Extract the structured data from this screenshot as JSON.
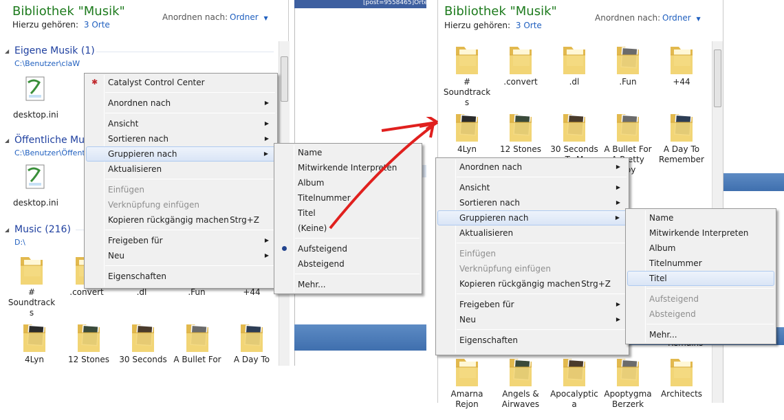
{
  "left": {
    "title": "Bibliothek \"Musik\"",
    "subtitle_prefix": "Hierzu gehören:",
    "subtitle_link": "3 Orte",
    "arrange_label": "Anordnen nach:",
    "arrange_value": "Ordner",
    "groups": [
      {
        "name": "Eigene Musik (1)",
        "path": "C:\\Benutzer\\claW",
        "items": [
          "desktop.ini"
        ]
      },
      {
        "name": "Öffentliche Musik",
        "path": "C:\\Benutzer\\Öffentlich",
        "items": [
          "desktop.ini"
        ]
      },
      {
        "name": "Music (216)",
        "path": "D:\\",
        "items": [
          "# Soundtracks",
          ".convert",
          ".dl",
          ".Fun",
          "+44",
          "4Lyn",
          "12 Stones",
          "30 Seconds",
          "A Bullet For",
          "A Day To"
        ]
      }
    ],
    "middle_header": "[post=9558465]Orte"
  },
  "menu_left": {
    "items": [
      {
        "label": "Catalyst Control Center",
        "icon": "catalyst-icon"
      },
      {
        "label": "Anordnen nach",
        "submenu": true
      },
      {
        "label": "Ansicht",
        "submenu": true
      },
      {
        "label": "Sortieren nach",
        "submenu": true
      },
      {
        "label": "Gruppieren nach",
        "submenu": true,
        "highlighted": true
      },
      {
        "label": "Aktualisieren"
      },
      {
        "label": "Einfügen",
        "disabled": true
      },
      {
        "label": "Verknüpfung einfügen",
        "disabled": true
      },
      {
        "label": "Kopieren rückgängig machen",
        "shortcut": "Strg+Z"
      },
      {
        "label": "Freigeben für",
        "submenu": true
      },
      {
        "label": "Neu",
        "submenu": true
      },
      {
        "label": "Eigenschaften"
      }
    ]
  },
  "submenu_left": {
    "items": [
      "Name",
      "Mitwirkende Interpreten",
      "Album",
      "Titelnummer",
      "Titel",
      "(Keine)",
      "Aufsteigend",
      "Absteigend",
      "Mehr..."
    ],
    "selected": "Aufsteigend"
  },
  "right": {
    "title": "Bibliothek \"Musik\"",
    "subtitle_prefix": "Hierzu gehören:",
    "subtitle_link": "3 Orte",
    "arrange_label": "Anordnen nach:",
    "arrange_value": "Ordner",
    "row1": [
      "# Soundtracks",
      ".convert",
      ".dl",
      ".Fun",
      "+44"
    ],
    "row2": [
      "4Lyn",
      "12 Stones",
      "30 Seconds To M",
      "A Bullet For A Pretty Boy",
      "A Day To Remember"
    ],
    "row_bottom": [
      "Amarna Rejon",
      "Angels & Airwaves",
      "Apocalyptica",
      "Apoptygma Berzerk",
      "Architects"
    ],
    "partial_label": "Remains"
  },
  "menu_right": {
    "items": [
      {
        "label": "Anordnen nach",
        "submenu": true
      },
      {
        "label": "Ansicht",
        "submenu": true
      },
      {
        "label": "Sortieren nach",
        "submenu": true
      },
      {
        "label": "Gruppieren nach",
        "submenu": true,
        "highlighted": true
      },
      {
        "label": "Aktualisieren"
      },
      {
        "label": "Einfügen",
        "disabled": true
      },
      {
        "label": "Verknüpfung einfügen",
        "disabled": true
      },
      {
        "label": "Kopieren rückgängig machen",
        "shortcut": "Strg+Z"
      },
      {
        "label": "Freigeben für",
        "submenu": true
      },
      {
        "label": "Neu",
        "submenu": true
      },
      {
        "label": "Eigenschaften"
      }
    ]
  },
  "submenu_right": {
    "items": [
      "Name",
      "Mitwirkende Interpreten",
      "Album",
      "Titelnummer",
      "Titel",
      "Aufsteigend",
      "Absteigend",
      "Mehr..."
    ],
    "highlighted": "Titel",
    "disabled": [
      "Aufsteigend",
      "Absteigend"
    ]
  },
  "colors": {
    "accent": "#1f5fbf",
    "title_green": "#1e7b1e",
    "arrow_red": "#e0201e",
    "band_blue": "#4a78b5"
  }
}
